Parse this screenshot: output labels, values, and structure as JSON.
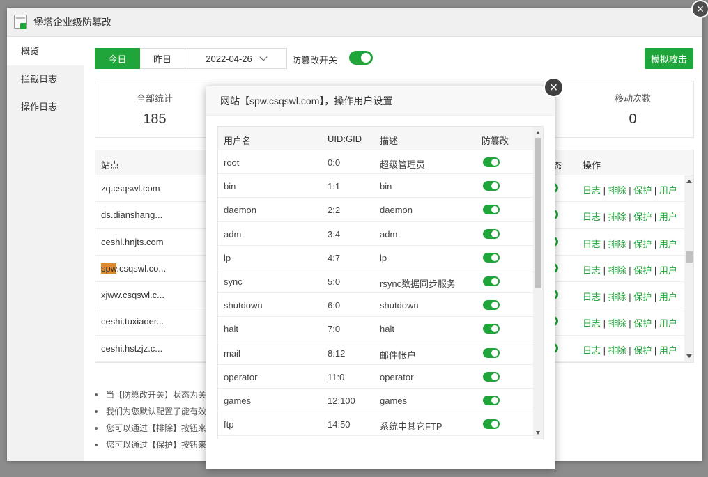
{
  "window": {
    "title": "堡塔企业级防篡改",
    "close_glyph": "×"
  },
  "sidebar": {
    "items": [
      {
        "label": "概览"
      },
      {
        "label": "拦截日志"
      },
      {
        "label": "操作日志"
      }
    ]
  },
  "toolbar": {
    "today": "今日",
    "yesterday": "昨日",
    "date": "2022-04-26",
    "switch_label": "防篡改开关",
    "switch_on": true,
    "attack_button": "模拟攻击"
  },
  "stats": [
    {
      "label": "全部统计",
      "value": "185"
    },
    {
      "label": "移动次数",
      "value": "0"
    }
  ],
  "site_table": {
    "columns": {
      "site": "站点",
      "status": "态",
      "ops": "操作"
    },
    "rows": [
      {
        "site": "zq.csqswl.com"
      },
      {
        "site": "ds.dianshang..."
      },
      {
        "site": "ceshi.hnjts.com"
      },
      {
        "site_highlight": "spw",
        "site_rest": ".csqswl.co..."
      },
      {
        "site": "xjww.csqswl.c..."
      },
      {
        "site": "ceshi.tuxiaoer..."
      },
      {
        "site": "ceshi.hstzjz.c..."
      }
    ],
    "ops": {
      "log": "日志",
      "exclude": "排除",
      "protect": "保护",
      "user": "用户",
      "sep": " | "
    }
  },
  "notes": [
    "当【防篡改开关】状态为关",
    "我们为您默认配置了能有效",
    "您可以通过【排除】按钮来",
    "您可以通过【保护】按钮来"
  ],
  "modal": {
    "title": "网站【spw.csqswl.com】，操作用户设置",
    "close_glyph": "×",
    "columns": {
      "user": "用户名",
      "uid": "UID:GID",
      "desc": "描述",
      "tamper": "防篡改"
    },
    "rows": [
      {
        "user": "root",
        "uid": "0:0",
        "desc": "超级管理员",
        "enabled": true
      },
      {
        "user": "bin",
        "uid": "1:1",
        "desc": "bin",
        "enabled": true
      },
      {
        "user": "daemon",
        "uid": "2:2",
        "desc": "daemon",
        "enabled": true
      },
      {
        "user": "adm",
        "uid": "3:4",
        "desc": "adm",
        "enabled": true
      },
      {
        "user": "lp",
        "uid": "4:7",
        "desc": "lp",
        "enabled": true
      },
      {
        "user": "sync",
        "uid": "5:0",
        "desc": "rsync数据同步服务",
        "enabled": true
      },
      {
        "user": "shutdown",
        "uid": "6:0",
        "desc": "shutdown",
        "enabled": true
      },
      {
        "user": "halt",
        "uid": "7:0",
        "desc": "halt",
        "enabled": true
      },
      {
        "user": "mail",
        "uid": "8:12",
        "desc": "邮件帐户",
        "enabled": true
      },
      {
        "user": "operator",
        "uid": "11:0",
        "desc": "operator",
        "enabled": true
      },
      {
        "user": "games",
        "uid": "12:100",
        "desc": "games",
        "enabled": true
      },
      {
        "user": "ftp",
        "uid": "14:50",
        "desc": "系统中其它FTP",
        "enabled": true
      }
    ]
  },
  "colors": {
    "accent": "#20a53a",
    "overlay": "#8c8c8c"
  }
}
